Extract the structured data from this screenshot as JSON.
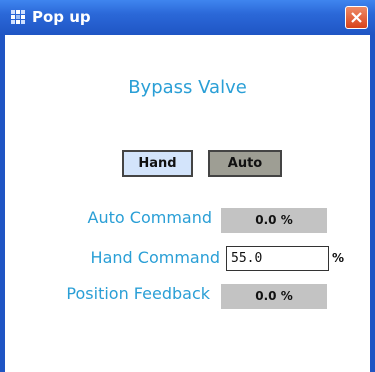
{
  "window": {
    "title": "Pop up"
  },
  "panel": {
    "heading": "Bypass Valve",
    "hand_label": "Hand",
    "auto_label": "Auto",
    "auto_command": {
      "label": "Auto Command",
      "value": "0.0 %"
    },
    "hand_command": {
      "label": "Hand Command",
      "value": "55.0",
      "unit": "%"
    },
    "position_feedback": {
      "label": "Position Feedback",
      "value": "0.0 %"
    }
  },
  "colors": {
    "title_bar": "#2b68d8",
    "label_text": "#2a9fd6",
    "hand_button": "#d3e4fb",
    "auto_button": "#9e9e94",
    "readout_bg": "#c3c3c3",
    "close_button": "#d8431b"
  },
  "icons": {
    "app": "app-grid-icon",
    "close": "close-icon"
  }
}
